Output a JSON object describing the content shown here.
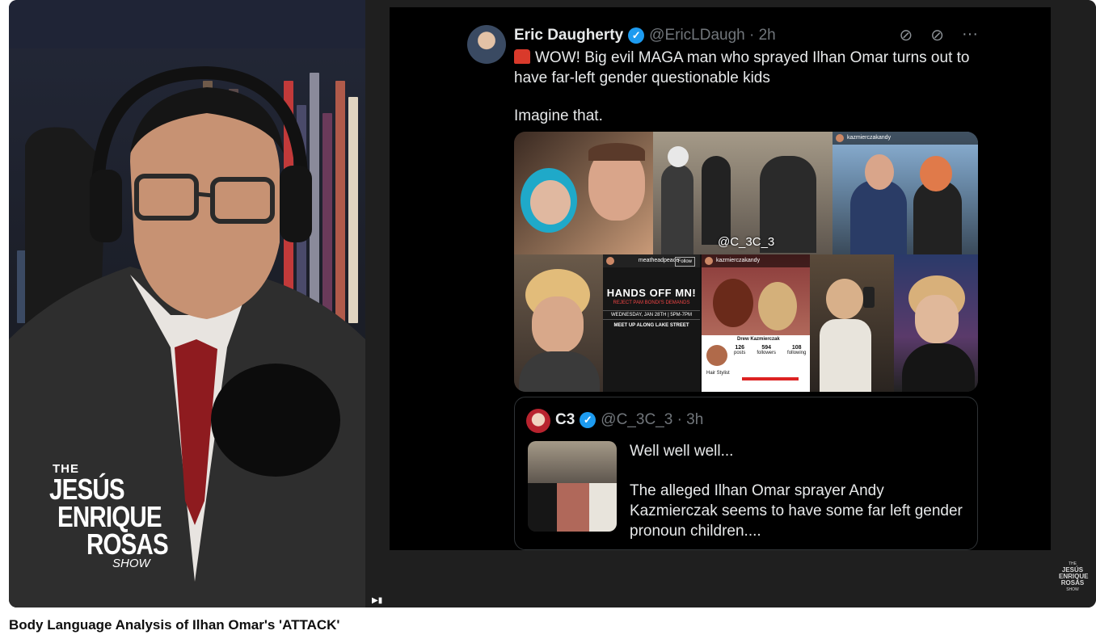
{
  "video": {
    "title": "Body Language Analysis of Ilhan Omar's 'ATTACK'"
  },
  "overlay_logo": {
    "the": "THE",
    "line1": "JESÚS",
    "line2": "ENRIQUE",
    "line3": "ROSAS",
    "show": "SHOW"
  },
  "watermark": {
    "the": "THE",
    "line1": "JESÚS",
    "line2": "ENRIQUE",
    "line3": "ROSAS",
    "show": "SHOW"
  },
  "tweet": {
    "author_name": "Eric Daugherty",
    "handle_time": "@EricLDaugh · 2h",
    "body_line1": "WOW! Big evil MAGA man who sprayed Ilhan Omar turns out to have far-left gender questionable kids",
    "body_line2": "Imagine that.",
    "icons": [
      "block-icon",
      "grok-icon",
      "more-icon"
    ],
    "media": {
      "watermark_text": "@C_3C_3",
      "ig_handle_1": "kazmierczakandy",
      "ig_handle_2": "kazmierczakandy",
      "ig_handle_3": "meatheadpeace",
      "follow_label": "Follow",
      "poster_title": "HANDS OFF MN!",
      "poster_sub": "REJECT PAM BONDI'S DEMANDS",
      "poster_date": "WEDNESDAY, JAN 28TH | 5PM-7PM",
      "poster_meet": "MEET UP ALONG LAKE STREET",
      "profile_name": "Drew Kazmierczak",
      "profile_stats": [
        {
          "value": "126",
          "label": "posts"
        },
        {
          "value": "594",
          "label": "followers"
        },
        {
          "value": "108",
          "label": "following"
        }
      ],
      "profile_bio": "Hair Stylist"
    }
  },
  "quote": {
    "author_name": "C3",
    "handle_time": "@C_3C_3 · 3h",
    "line1": "Well well well...",
    "line2": "The alleged Ilhan Omar sprayer Andy Kazmierczak seems to have some far left gender pronoun children...."
  }
}
